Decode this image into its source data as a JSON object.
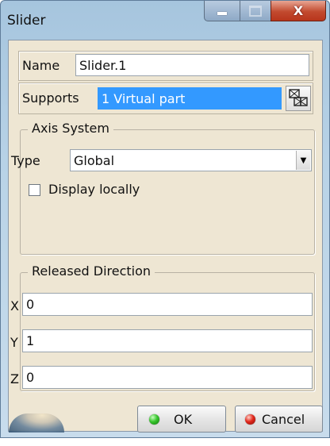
{
  "window": {
    "title": "Slider",
    "controls": {
      "minimize": "minimize",
      "maximize": "maximize",
      "close": "X"
    }
  },
  "name_row": {
    "label": "Name",
    "value": "Slider.1"
  },
  "supports_row": {
    "label": "Supports",
    "value": "1 Virtual part",
    "button_icon": "selection-list-icon"
  },
  "axis_system": {
    "legend": "Axis System",
    "type_label": "Type",
    "type_value": "Global",
    "display_locally_label": "Display locally",
    "display_locally_checked": false
  },
  "released_direction": {
    "legend": "Released Direction",
    "x_label": "X",
    "x_value": "0",
    "y_label": "Y",
    "y_value": "1",
    "z_label": "Z",
    "z_value": "0"
  },
  "buttons": {
    "ok": "OK",
    "cancel": "Cancel"
  },
  "colors": {
    "selection_highlight": "#3399ff",
    "panel": "#eee6d3",
    "title_bar": "#a6c5de"
  }
}
